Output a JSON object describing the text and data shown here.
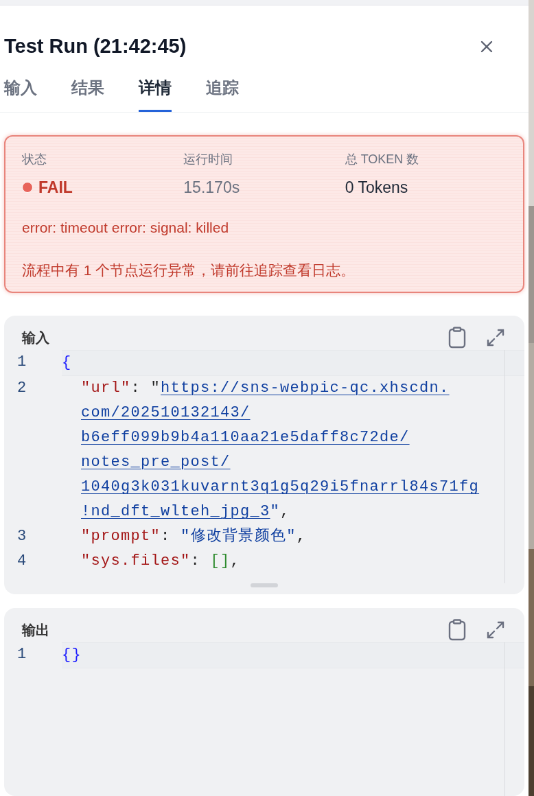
{
  "panel": {
    "title": "Test Run (21:42:45)"
  },
  "tabs": [
    {
      "label": "输入",
      "selected": false
    },
    {
      "label": "结果",
      "selected": false
    },
    {
      "label": "详情",
      "selected": true
    },
    {
      "label": "追踪",
      "selected": false
    }
  ],
  "summary": {
    "failed": true,
    "stats": [
      {
        "label": "状态",
        "value": "FAIL",
        "kind": "status",
        "color": "#e8635a"
      },
      {
        "label": "运行时间",
        "value": "15.170s",
        "kind": "muted"
      },
      {
        "label": "总 TOKEN 数",
        "value": "0 Tokens",
        "kind": "plain"
      }
    ],
    "messages": [
      "error: timeout error: signal: killed",
      "流程中有 1 个节点运行异常，请前往追踪查看日志。"
    ]
  },
  "code_panels": [
    {
      "title": "输入",
      "lines": [
        {
          "number": "1",
          "tokens": [
            {
              "kind": "brace",
              "text": "{"
            }
          ]
        },
        {
          "number": "2",
          "tokens": [
            {
              "kind": "key",
              "text": "\"url\""
            },
            {
              "kind": "punct",
              "text": ": \""
            },
            {
              "kind": "link",
              "lines": [
                "https://sns-webpic-qc.xhscdn.",
                "com/202510132143/",
                "b6eff099b9b4a110aa21e5daff8c72de/",
                "notes_pre_post/",
                "1040g3k031kuvarnt3q1g5q29i5fnarrl84s71fg",
                "!nd_dft_wlteh_jpg_3"
              ]
            },
            {
              "kind": "string",
              "text": "\""
            },
            {
              "kind": "punct",
              "text": ","
            }
          ]
        },
        {
          "number": "3",
          "tokens": [
            {
              "kind": "key",
              "text": "\"prompt\""
            },
            {
              "kind": "punct",
              "text": ": "
            },
            {
              "kind": "string",
              "text": "\"修改背景颜色\""
            },
            {
              "kind": "punct",
              "text": ","
            }
          ]
        },
        {
          "number": "4",
          "tokens": [
            {
              "kind": "key",
              "text": "\"sys.files\""
            },
            {
              "kind": "punct",
              "text": ": "
            },
            {
              "kind": "array",
              "text": "[]"
            },
            {
              "kind": "punct",
              "text": ","
            }
          ]
        }
      ],
      "resizable": true
    },
    {
      "title": "输出",
      "lines": [
        {
          "number": "1",
          "tokens": [
            {
              "kind": "brace",
              "text": "{}"
            }
          ]
        }
      ],
      "resizable": false
    }
  ]
}
